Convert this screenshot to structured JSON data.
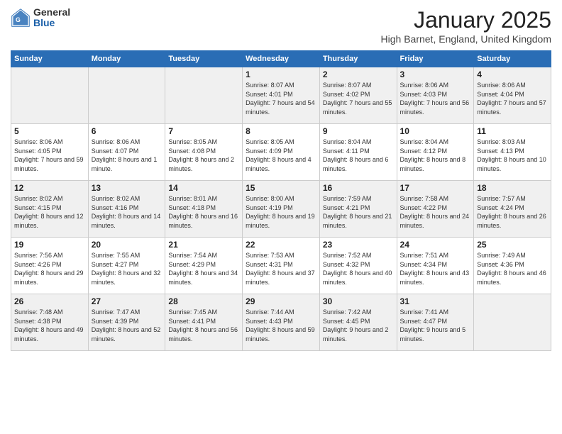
{
  "logo": {
    "general": "General",
    "blue": "Blue"
  },
  "header": {
    "month": "January 2025",
    "location": "High Barnet, England, United Kingdom"
  },
  "weekdays": [
    "Sunday",
    "Monday",
    "Tuesday",
    "Wednesday",
    "Thursday",
    "Friday",
    "Saturday"
  ],
  "weeks": [
    [
      {
        "day": "",
        "sunrise": "",
        "sunset": "",
        "daylight": ""
      },
      {
        "day": "",
        "sunrise": "",
        "sunset": "",
        "daylight": ""
      },
      {
        "day": "",
        "sunrise": "",
        "sunset": "",
        "daylight": ""
      },
      {
        "day": "1",
        "sunrise": "Sunrise: 8:07 AM",
        "sunset": "Sunset: 4:01 PM",
        "daylight": "Daylight: 7 hours and 54 minutes."
      },
      {
        "day": "2",
        "sunrise": "Sunrise: 8:07 AM",
        "sunset": "Sunset: 4:02 PM",
        "daylight": "Daylight: 7 hours and 55 minutes."
      },
      {
        "day": "3",
        "sunrise": "Sunrise: 8:06 AM",
        "sunset": "Sunset: 4:03 PM",
        "daylight": "Daylight: 7 hours and 56 minutes."
      },
      {
        "day": "4",
        "sunrise": "Sunrise: 8:06 AM",
        "sunset": "Sunset: 4:04 PM",
        "daylight": "Daylight: 7 hours and 57 minutes."
      }
    ],
    [
      {
        "day": "5",
        "sunrise": "Sunrise: 8:06 AM",
        "sunset": "Sunset: 4:05 PM",
        "daylight": "Daylight: 7 hours and 59 minutes."
      },
      {
        "day": "6",
        "sunrise": "Sunrise: 8:06 AM",
        "sunset": "Sunset: 4:07 PM",
        "daylight": "Daylight: 8 hours and 1 minute."
      },
      {
        "day": "7",
        "sunrise": "Sunrise: 8:05 AM",
        "sunset": "Sunset: 4:08 PM",
        "daylight": "Daylight: 8 hours and 2 minutes."
      },
      {
        "day": "8",
        "sunrise": "Sunrise: 8:05 AM",
        "sunset": "Sunset: 4:09 PM",
        "daylight": "Daylight: 8 hours and 4 minutes."
      },
      {
        "day": "9",
        "sunrise": "Sunrise: 8:04 AM",
        "sunset": "Sunset: 4:11 PM",
        "daylight": "Daylight: 8 hours and 6 minutes."
      },
      {
        "day": "10",
        "sunrise": "Sunrise: 8:04 AM",
        "sunset": "Sunset: 4:12 PM",
        "daylight": "Daylight: 8 hours and 8 minutes."
      },
      {
        "day": "11",
        "sunrise": "Sunrise: 8:03 AM",
        "sunset": "Sunset: 4:13 PM",
        "daylight": "Daylight: 8 hours and 10 minutes."
      }
    ],
    [
      {
        "day": "12",
        "sunrise": "Sunrise: 8:02 AM",
        "sunset": "Sunset: 4:15 PM",
        "daylight": "Daylight: 8 hours and 12 minutes."
      },
      {
        "day": "13",
        "sunrise": "Sunrise: 8:02 AM",
        "sunset": "Sunset: 4:16 PM",
        "daylight": "Daylight: 8 hours and 14 minutes."
      },
      {
        "day": "14",
        "sunrise": "Sunrise: 8:01 AM",
        "sunset": "Sunset: 4:18 PM",
        "daylight": "Daylight: 8 hours and 16 minutes."
      },
      {
        "day": "15",
        "sunrise": "Sunrise: 8:00 AM",
        "sunset": "Sunset: 4:19 PM",
        "daylight": "Daylight: 8 hours and 19 minutes."
      },
      {
        "day": "16",
        "sunrise": "Sunrise: 7:59 AM",
        "sunset": "Sunset: 4:21 PM",
        "daylight": "Daylight: 8 hours and 21 minutes."
      },
      {
        "day": "17",
        "sunrise": "Sunrise: 7:58 AM",
        "sunset": "Sunset: 4:22 PM",
        "daylight": "Daylight: 8 hours and 24 minutes."
      },
      {
        "day": "18",
        "sunrise": "Sunrise: 7:57 AM",
        "sunset": "Sunset: 4:24 PM",
        "daylight": "Daylight: 8 hours and 26 minutes."
      }
    ],
    [
      {
        "day": "19",
        "sunrise": "Sunrise: 7:56 AM",
        "sunset": "Sunset: 4:26 PM",
        "daylight": "Daylight: 8 hours and 29 minutes."
      },
      {
        "day": "20",
        "sunrise": "Sunrise: 7:55 AM",
        "sunset": "Sunset: 4:27 PM",
        "daylight": "Daylight: 8 hours and 32 minutes."
      },
      {
        "day": "21",
        "sunrise": "Sunrise: 7:54 AM",
        "sunset": "Sunset: 4:29 PM",
        "daylight": "Daylight: 8 hours and 34 minutes."
      },
      {
        "day": "22",
        "sunrise": "Sunrise: 7:53 AM",
        "sunset": "Sunset: 4:31 PM",
        "daylight": "Daylight: 8 hours and 37 minutes."
      },
      {
        "day": "23",
        "sunrise": "Sunrise: 7:52 AM",
        "sunset": "Sunset: 4:32 PM",
        "daylight": "Daylight: 8 hours and 40 minutes."
      },
      {
        "day": "24",
        "sunrise": "Sunrise: 7:51 AM",
        "sunset": "Sunset: 4:34 PM",
        "daylight": "Daylight: 8 hours and 43 minutes."
      },
      {
        "day": "25",
        "sunrise": "Sunrise: 7:49 AM",
        "sunset": "Sunset: 4:36 PM",
        "daylight": "Daylight: 8 hours and 46 minutes."
      }
    ],
    [
      {
        "day": "26",
        "sunrise": "Sunrise: 7:48 AM",
        "sunset": "Sunset: 4:38 PM",
        "daylight": "Daylight: 8 hours and 49 minutes."
      },
      {
        "day": "27",
        "sunrise": "Sunrise: 7:47 AM",
        "sunset": "Sunset: 4:39 PM",
        "daylight": "Daylight: 8 hours and 52 minutes."
      },
      {
        "day": "28",
        "sunrise": "Sunrise: 7:45 AM",
        "sunset": "Sunset: 4:41 PM",
        "daylight": "Daylight: 8 hours and 56 minutes."
      },
      {
        "day": "29",
        "sunrise": "Sunrise: 7:44 AM",
        "sunset": "Sunset: 4:43 PM",
        "daylight": "Daylight: 8 hours and 59 minutes."
      },
      {
        "day": "30",
        "sunrise": "Sunrise: 7:42 AM",
        "sunset": "Sunset: 4:45 PM",
        "daylight": "Daylight: 9 hours and 2 minutes."
      },
      {
        "day": "31",
        "sunrise": "Sunrise: 7:41 AM",
        "sunset": "Sunset: 4:47 PM",
        "daylight": "Daylight: 9 hours and 5 minutes."
      },
      {
        "day": "",
        "sunrise": "",
        "sunset": "",
        "daylight": ""
      }
    ]
  ]
}
